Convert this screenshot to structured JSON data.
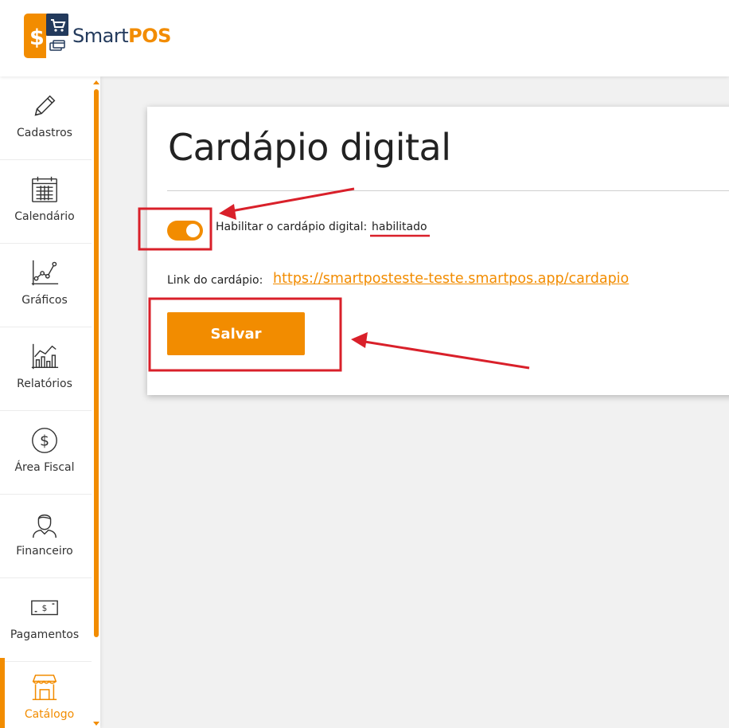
{
  "brand": {
    "part1": "Smart",
    "part2": "POS"
  },
  "sidebar": {
    "items": [
      {
        "label": "Cadastros",
        "icon": "pencil-icon"
      },
      {
        "label": "Calendário",
        "icon": "calendar-icon"
      },
      {
        "label": "Gráficos",
        "icon": "line-chart-icon"
      },
      {
        "label": "Relatórios",
        "icon": "bar-chart-icon"
      },
      {
        "label": "Área Fiscal",
        "icon": "dollar-circle-icon"
      },
      {
        "label": "Financeiro",
        "icon": "person-icon"
      },
      {
        "label": "Pagamentos",
        "icon": "banknote-icon"
      },
      {
        "label": "Catálogo",
        "icon": "storefront-icon",
        "active": true
      }
    ]
  },
  "main": {
    "title": "Cardápio digital",
    "enable_label": "Habilitar o cardápio digital:",
    "enable_status": "habilitado",
    "toggle_on": true,
    "link_label": "Link do cardápio:",
    "link_url": "https://smartposteste-teste.smartpos.app/cardapio",
    "save_label": "Salvar"
  },
  "colors": {
    "accent": "#f28c00",
    "navy": "#233a5c",
    "annotation": "#d9202a"
  }
}
